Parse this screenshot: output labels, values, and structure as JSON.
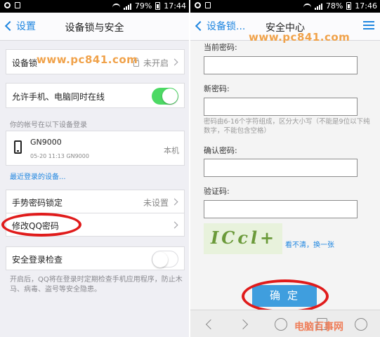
{
  "left": {
    "status": {
      "battery": "79%",
      "time": "17:44"
    },
    "nav": {
      "back_label": "设置",
      "title": "设备锁与安全"
    },
    "watermark": "www.pc841.com",
    "device_lock": {
      "label": "设备锁",
      "value": "未开启"
    },
    "online_toggle": {
      "label": "允许手机、电脑同时在线",
      "on": true
    },
    "devices_section": "你的帐号在以下设备登录",
    "device": {
      "name": "GN9000",
      "detail": "05-20 11:13 GN9000",
      "type": "本机"
    },
    "recent_link": "最近登录的设备...",
    "gesture_lock": {
      "label": "手势密码锁定",
      "value": "未设置"
    },
    "change_qq_password": {
      "label": "修改QQ密码"
    },
    "login_check": {
      "label": "安全登录检查",
      "on": false
    },
    "login_check_note": "开启后，QQ将在登录时定期检查手机应用程序，防止木马、病毒、盗号等安全隐患。"
  },
  "right": {
    "status": {
      "battery": "78%",
      "time": "17:46"
    },
    "nav": {
      "back_label": "设备锁...",
      "title": "安全中心"
    },
    "watermark": "www.pc841.com",
    "current_password_label": "当前密码:",
    "new_password_label": "新密码:",
    "password_hint": "密码由6-16个字符组成，区分大小写（不能是9位以下纯数字，不能包含空格）",
    "confirm_password_label": "确认密码:",
    "captcha_label": "验证码:",
    "captcha_text": "ICcl+",
    "refresh_link": "看不清，换一张",
    "confirm_button": "确定",
    "bottom_watermark": "电脑百事网"
  },
  "colors": {
    "accent": "#1f86e0",
    "toggle_on": "#4cd964",
    "highlight": "#e01b1b",
    "watermark": "#f0a24a"
  }
}
